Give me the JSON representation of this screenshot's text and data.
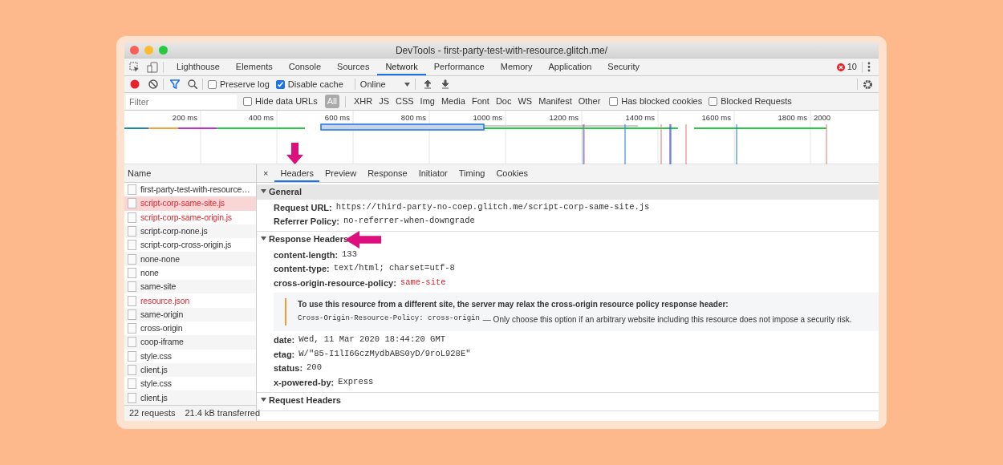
{
  "window": {
    "title": "DevTools - first-party-test-with-resource.glitch.me/"
  },
  "panel_tabs": [
    {
      "label": "Lighthouse",
      "selected": false
    },
    {
      "label": "Elements",
      "selected": false
    },
    {
      "label": "Console",
      "selected": false
    },
    {
      "label": "Sources",
      "selected": false
    },
    {
      "label": "Network",
      "selected": true
    },
    {
      "label": "Performance",
      "selected": false
    },
    {
      "label": "Memory",
      "selected": false
    },
    {
      "label": "Application",
      "selected": false
    },
    {
      "label": "Security",
      "selected": false
    }
  ],
  "error_count": "10",
  "toolbar": {
    "recording": true,
    "preserve_log": {
      "label": "Preserve log",
      "checked": false
    },
    "disable_cache": {
      "label": "Disable cache",
      "checked": true
    },
    "throttling": "Online"
  },
  "filter_bar": {
    "placeholder": "Filter",
    "hide_data_urls": {
      "label": "Hide data URLs",
      "checked": false
    },
    "types": [
      {
        "label": "All",
        "selected": true
      },
      {
        "label": "XHR",
        "selected": false
      },
      {
        "label": "JS",
        "selected": false
      },
      {
        "label": "CSS",
        "selected": false
      },
      {
        "label": "Img",
        "selected": false
      },
      {
        "label": "Media",
        "selected": false
      },
      {
        "label": "Font",
        "selected": false
      },
      {
        "label": "Doc",
        "selected": false
      },
      {
        "label": "WS",
        "selected": false
      },
      {
        "label": "Manifest",
        "selected": false
      },
      {
        "label": "Other",
        "selected": false
      }
    ],
    "has_blocked_cookies": {
      "label": "Has blocked cookies",
      "checked": false
    },
    "blocked_requests": {
      "label": "Blocked Requests",
      "checked": false
    }
  },
  "timeline": {
    "ticks": [
      "200 ms",
      "400 ms",
      "600 ms",
      "800 ms",
      "1000 ms",
      "1200 ms",
      "1400 ms",
      "1600 ms",
      "1800 ms",
      "2000"
    ]
  },
  "requests": {
    "column": "Name",
    "rows": [
      {
        "name": "first-party-test-with-resource…",
        "failed": false,
        "selected": false
      },
      {
        "name": "script-corp-same-site.js",
        "failed": true,
        "selected": true
      },
      {
        "name": "script-corp-same-origin.js",
        "failed": true,
        "selected": false
      },
      {
        "name": "script-corp-none.js",
        "failed": false,
        "selected": false
      },
      {
        "name": "script-corp-cross-origin.js",
        "failed": false,
        "selected": false
      },
      {
        "name": "none-none",
        "failed": false,
        "selected": false
      },
      {
        "name": "none",
        "failed": false,
        "selected": false
      },
      {
        "name": "same-site",
        "failed": false,
        "selected": false
      },
      {
        "name": "resource.json",
        "failed": true,
        "selected": false
      },
      {
        "name": "same-origin",
        "failed": false,
        "selected": false
      },
      {
        "name": "cross-origin",
        "failed": false,
        "selected": false
      },
      {
        "name": "coop-iframe",
        "failed": false,
        "selected": false
      },
      {
        "name": "style.css",
        "failed": false,
        "selected": false
      },
      {
        "name": "client.js",
        "failed": false,
        "selected": false
      },
      {
        "name": "style.css",
        "failed": false,
        "selected": false
      },
      {
        "name": "client.js",
        "failed": false,
        "selected": false
      }
    ]
  },
  "status_bar": {
    "requests": "22 requests",
    "transferred": "21.4 kB transferred"
  },
  "detail": {
    "close": "×",
    "tabs": [
      {
        "label": "Headers",
        "selected": true
      },
      {
        "label": "Preview",
        "selected": false
      },
      {
        "label": "Response",
        "selected": false
      },
      {
        "label": "Initiator",
        "selected": false
      },
      {
        "label": "Timing",
        "selected": false
      },
      {
        "label": "Cookies",
        "selected": false
      }
    ],
    "sections": [
      {
        "title": "General",
        "expanded": true,
        "shaded": true,
        "items": [
          {
            "kind": "header",
            "name": "Request URL:",
            "value": "https://third-party-no-coep.glitch.me/script-corp-same-site.js",
            "error": false
          },
          {
            "kind": "header",
            "name": "Referrer Policy:",
            "value": "no-referrer-when-downgrade",
            "error": false
          }
        ]
      },
      {
        "title": "Response Headers",
        "expanded": true,
        "shaded": false,
        "items": [
          {
            "kind": "header",
            "name": "content-length:",
            "value": "133",
            "error": false
          },
          {
            "kind": "header",
            "name": "content-type:",
            "value": "text/html; charset=utf-8",
            "error": false
          },
          {
            "kind": "header",
            "name": "cross-origin-resource-policy:",
            "value": "same-site",
            "error": true
          },
          {
            "kind": "note",
            "title": "To use this resource from a different site, the server may relax the cross-origin resource policy response header:",
            "code": "Cross-Origin-Resource-Policy: cross-origin",
            "text": "— Only choose this option if an arbitrary website including this resource does not impose a security risk."
          },
          {
            "kind": "header",
            "name": "date:",
            "value": "Wed, 11 Mar 2020 18:44:20 GMT",
            "error": false
          },
          {
            "kind": "header",
            "name": "etag:",
            "value": "W/\"85-I1lI6GczMydbABS0yD/9roL928E\"",
            "error": false
          },
          {
            "kind": "header",
            "name": "status:",
            "value": "200",
            "error": false
          },
          {
            "kind": "header",
            "name": "x-powered-by:",
            "value": "Express",
            "error": false
          }
        ]
      },
      {
        "title": "Request Headers",
        "expanded": true,
        "shaded": false
      }
    ]
  }
}
